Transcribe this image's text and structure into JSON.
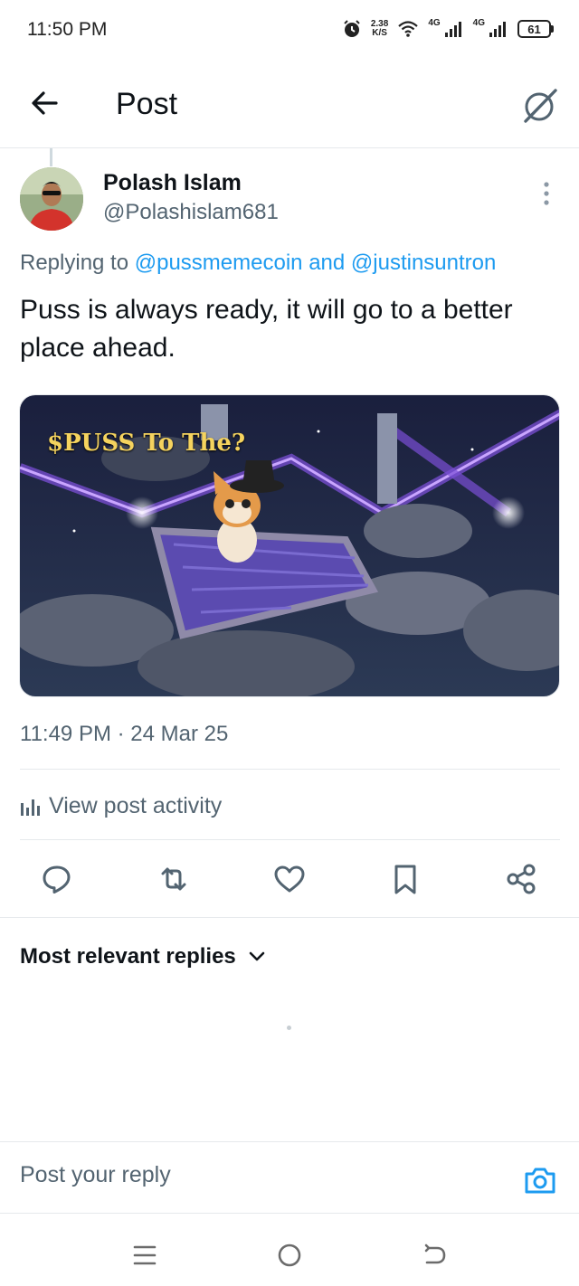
{
  "status_bar": {
    "time": "11:50 PM",
    "net_speed_value": "2.38",
    "net_speed_unit": "K/S",
    "signal_1_tag": "4G",
    "signal_2_tag": "4G",
    "battery": "61"
  },
  "header": {
    "title": "Post",
    "back_icon": "arrow-left-icon",
    "grok_icon": "grok-slash-icon"
  },
  "post": {
    "author_name": "Polash Islam",
    "author_handle": "@Polashislam681",
    "replying_prefix": "Replying to",
    "replying_to_1": "@pussmemecoin",
    "replying_and": "and",
    "replying_to_2": "@justinsuntron",
    "text": "Puss is always ready, it will go to a better place ahead.",
    "media_caption": "$PUSS To The?",
    "timestamp": "11:49 PM · 24 Mar 25"
  },
  "activity": {
    "label": "View post activity",
    "icon": "bar-chart-icon"
  },
  "actions": [
    {
      "name": "reply",
      "icon": "reply-icon"
    },
    {
      "name": "repost",
      "icon": "repost-icon"
    },
    {
      "name": "like",
      "icon": "heart-icon"
    },
    {
      "name": "bookmark",
      "icon": "bookmark-icon"
    },
    {
      "name": "share",
      "icon": "share-icon"
    }
  ],
  "replies": {
    "filter_label": "Most relevant replies"
  },
  "reply_bar": {
    "placeholder": "Post your reply",
    "icon": "camera-icon"
  },
  "nav_bar": {
    "items": [
      "menu-icon",
      "home-circle-icon",
      "back-icon"
    ]
  },
  "colors": {
    "accent": "#1d9bf0",
    "text_primary": "#0f1419",
    "text_secondary": "#536471",
    "divider": "#e6e9ec"
  }
}
